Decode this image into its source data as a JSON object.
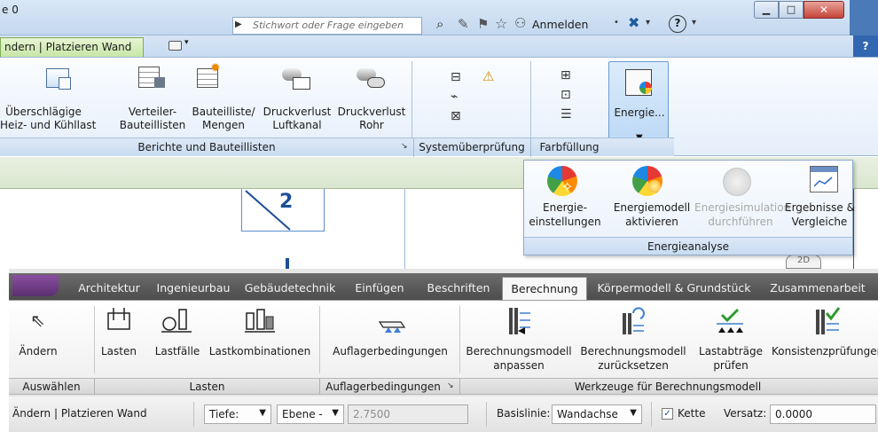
{
  "titlebar": {
    "title_fragment": "e 0",
    "search_placeholder": "Stichwort oder Frage eingeben",
    "signin_label": "Anmelden",
    "help_label": "?"
  },
  "context_tab": {
    "label": "ndern | Platzieren Wand"
  },
  "ribbon_top": {
    "buttons": [
      {
        "label1": "Überschlägige",
        "label2": "Heiz- und Kühllast"
      },
      {
        "label1": "Verteiler-",
        "label2": "Bauteillisten"
      },
      {
        "label1": "Bauteilliste/",
        "label2": "Mengen"
      },
      {
        "label1": "Druckverlust",
        "label2": "Luftkanal"
      },
      {
        "label1": "Druckverlust",
        "label2": "Rohr"
      }
    ],
    "energie_button": "Energie...",
    "groups": {
      "berichte": "Berichte und Bauteillisten",
      "system": "Systemüberprüfung",
      "farb": "Farbfüllung"
    }
  },
  "canvas": {
    "tag_number": "2"
  },
  "energy_dropdown": {
    "items": [
      {
        "label1": "Energie-",
        "label2": "einstellungen"
      },
      {
        "label1": "Energiemodell",
        "label2": "aktivieren"
      },
      {
        "label1": "Energiesimulation",
        "label2": "durchführen"
      },
      {
        "label1": "Ergebnisse &",
        "label2": "Vergleiche"
      }
    ],
    "group_label": "Energieanalyse"
  },
  "ribbon_bottom": {
    "tabs": [
      {
        "label": "Architektur"
      },
      {
        "label": "Ingenieurbau"
      },
      {
        "label": "Gebäudetechnik"
      },
      {
        "label": "Einfügen"
      },
      {
        "label": "Beschriften"
      },
      {
        "label": "Berechnung"
      },
      {
        "label": "Körpermodell & Grundstück"
      },
      {
        "label": "Zusammenarbeit"
      }
    ],
    "buttons": {
      "aendern": "Ändern",
      "lasten": "Lasten",
      "lastfaelle": "Lastfälle",
      "lastkombinationen": "Lastkombinationen",
      "auflager": "Auflagerbedingungen",
      "bm_anpassen_1": "Berechnungsmodell",
      "bm_anpassen_2": "anpassen",
      "bm_zurueck_1": "Berechnungsmodell",
      "bm_zurueck_2": "zurücksetzen",
      "lastabtrag_1": "Lastabträge",
      "lastabtrag_2": "prüfen",
      "konsistenz": "Konsistenzprüfungen"
    },
    "groups": {
      "auswaehlen": "Auswählen",
      "lasten": "Lasten",
      "auflager": "Auflagerbedingungen",
      "werkzeuge": "Werkzeuge für Berechnungsmodell"
    }
  },
  "options_bar": {
    "context": "Ändern | Platzieren Wand",
    "tiefe": "Tiefe:",
    "ebene": "Ebene -",
    "height_value": "2.7500",
    "basislinie_label": "Basislinie:",
    "basislinie_value": "Wandachse",
    "kette_label": "Kette",
    "versatz_label": "Versatz:",
    "versatz_value": "0.0000"
  },
  "colors": {
    "accent_blue": "#3d7fd0",
    "active_tab_bg": "#f7f7f7",
    "green_check": "#2f9b2f",
    "energy_highlight": "#c8dff6"
  }
}
